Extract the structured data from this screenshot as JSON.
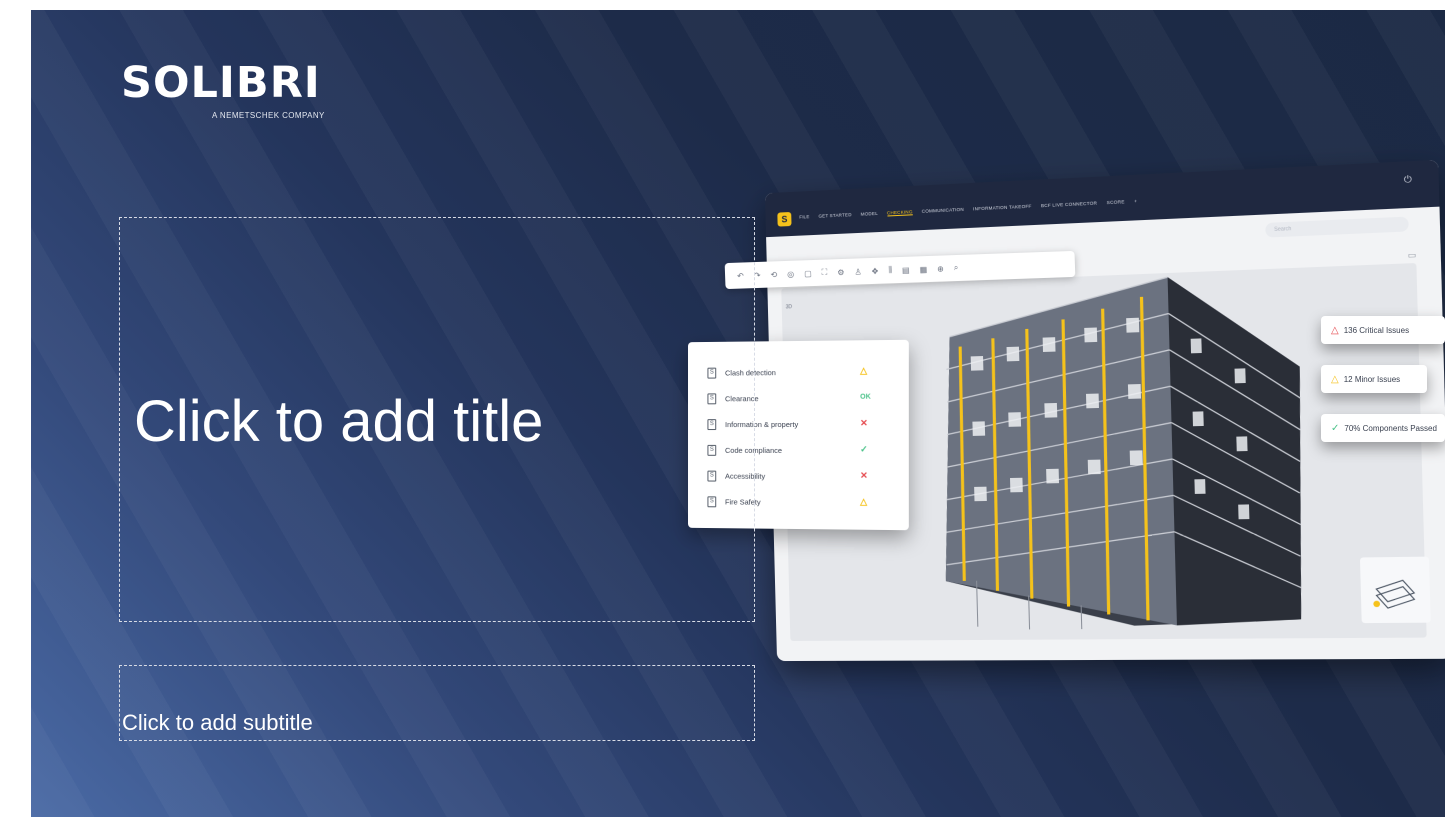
{
  "logo": {
    "word": "SOLIBRI",
    "tagline": "A NEMETSCHEK COMPANY"
  },
  "placeholders": {
    "title": "Click to add title",
    "subtitle": "Click to add subtitle"
  },
  "app": {
    "logo_letter": "S",
    "menu": [
      "FILE",
      "GET STARTED",
      "MODEL",
      "CHECKING",
      "COMMUNICATION",
      "INFORMATION TAKEOFF",
      "BCF LIVE CONNECTOR",
      "SCORE",
      "+"
    ],
    "active_menu": "CHECKING",
    "search_placeholder": "Search",
    "viewport_label": "3D",
    "accent_color": "#f5c21b"
  },
  "checks": [
    {
      "label": "Clash detection",
      "status": "warning",
      "symbol": "△",
      "color": "#f5c21b"
    },
    {
      "label": "Clearance",
      "status": "ok",
      "symbol": "OK",
      "color": "#4cc38a"
    },
    {
      "label": "Information & property",
      "status": "fail",
      "symbol": "✕",
      "color": "#e5484d"
    },
    {
      "label": "Code compliance",
      "status": "pass",
      "symbol": "✓",
      "color": "#4cc38a"
    },
    {
      "label": "Accessibility",
      "status": "fail",
      "symbol": "✕",
      "color": "#e5484d"
    },
    {
      "label": "Fire Safety",
      "status": "warning",
      "symbol": "△",
      "color": "#f5c21b"
    }
  ],
  "issues": [
    {
      "text": "136 Critical Issues",
      "icon": "△",
      "color": "#e5484d"
    },
    {
      "text": "12 Minor Issues",
      "icon": "△",
      "color": "#f5c21b"
    },
    {
      "text": "70% Components Passed",
      "icon": "✓",
      "color": "#4cc38a"
    }
  ]
}
